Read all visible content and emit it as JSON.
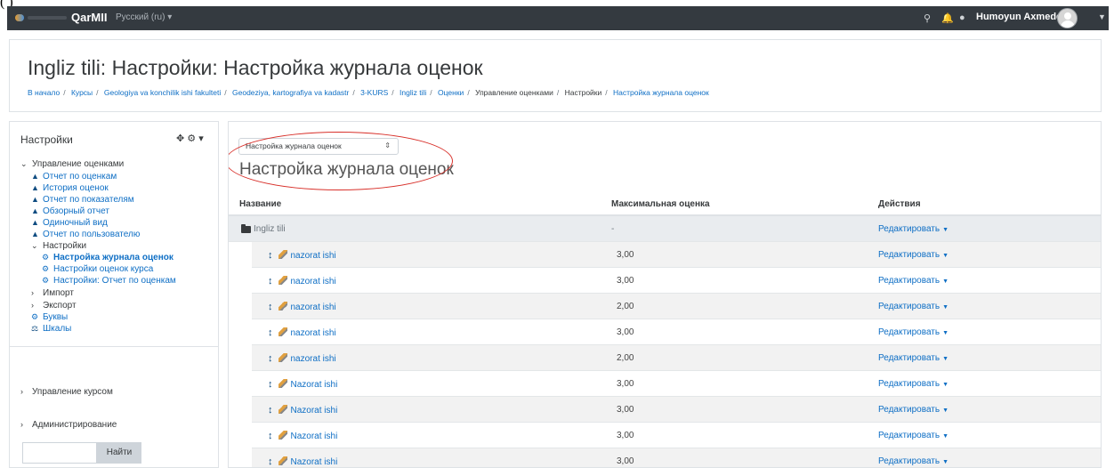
{
  "topbar": {
    "fragment": "(  )"
  },
  "navbar": {
    "site_name": "QarMII",
    "language": "Русский (ru) ▾",
    "username": "Humoyun Axmedov",
    "icons": [
      "search-icon",
      "bell-icon",
      "chat-icon",
      "avatar",
      "chevron-down-icon"
    ]
  },
  "header": {
    "title": "Ingliz tili: Настройки: Настройка журнала оценок",
    "breadcrumb": [
      "В начало",
      "Курсы",
      "Geologiya va konchilik ishi fakulteti",
      "Geodeziya, kartografiya va kadastr",
      "3-KURS",
      "Ingliz tili",
      "Оценки",
      "Управление оценками",
      "Настройки",
      "Настройка журнала оценок"
    ]
  },
  "sidebar": {
    "title": "Настройки",
    "grade_admin": "Управление оценками",
    "report_links": [
      "Отчет по оценкам",
      "История оценок",
      "Отчет по показателям",
      "Обзорный отчет",
      "Одиночный вид",
      "Отчет по пользователю"
    ],
    "settings_label": "Настройки",
    "settings_items": [
      "Настройка журнала оценок",
      "Настройки оценок курса",
      "Настройки: Отчет по оценкам"
    ],
    "import_label": "Импорт",
    "export_label": "Экспорт",
    "letters_label": "Буквы",
    "scales_label": "Шкалы",
    "course_admin": "Управление курсом",
    "site_admin": "Администрирование",
    "search_button": "Найти"
  },
  "main": {
    "selector": "Настройка журнала оценок",
    "heading": "Настройка журнала оценок",
    "columns": [
      "Название",
      "Максимальная оценка",
      "Действия"
    ],
    "category": {
      "name": "Ingliz tili",
      "max": "-",
      "action": "Редактировать"
    },
    "items": [
      {
        "name": "nazorat ishi",
        "max": "3,00",
        "action": "Редактировать"
      },
      {
        "name": "nazorat ishi",
        "max": "3,00",
        "action": "Редактировать"
      },
      {
        "name": "nazorat ishi",
        "max": "2,00",
        "action": "Редактировать"
      },
      {
        "name": "nazorat ishi",
        "max": "3,00",
        "action": "Редактировать"
      },
      {
        "name": "nazorat ishi",
        "max": "2,00",
        "action": "Редактировать"
      },
      {
        "name": "Nazorat ishi",
        "max": "3,00",
        "action": "Редактировать"
      },
      {
        "name": "Nazorat ishi",
        "max": "3,00",
        "action": "Редактировать"
      },
      {
        "name": "Nazorat ishi",
        "max": "3,00",
        "action": "Редактировать"
      },
      {
        "name": "Nazorat ishi",
        "max": "3,00",
        "action": "Редактировать"
      }
    ]
  },
  "colors": {
    "navbar": "#343a40",
    "link": "#0f6fc5",
    "annotation": "#d8302a",
    "category_row": "#e9ecef"
  }
}
